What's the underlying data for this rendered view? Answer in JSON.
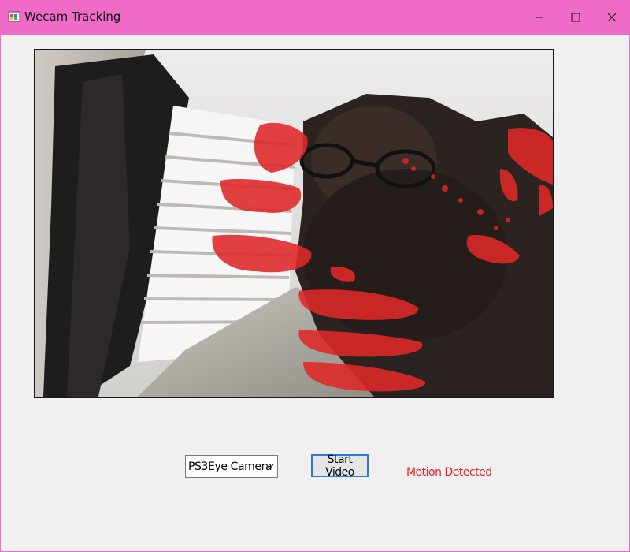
{
  "window": {
    "title": "Wecam Tracking",
    "icon": "form-app-icon",
    "controls": [
      "minimize-icon",
      "maximize-icon",
      "close-icon"
    ]
  },
  "video": {
    "description_icon": "webcam-feed",
    "overlay_color": "#e02828"
  },
  "camera_select": {
    "value": "PS3Eye Camera"
  },
  "start_button": {
    "label": "Start Video"
  },
  "status": {
    "text": "Motion Detected",
    "color": "#e8202a"
  },
  "colors": {
    "titlebar": "#f06ac8",
    "client_bg": "#f0f0f0",
    "button_border": "#2b7ad6"
  }
}
